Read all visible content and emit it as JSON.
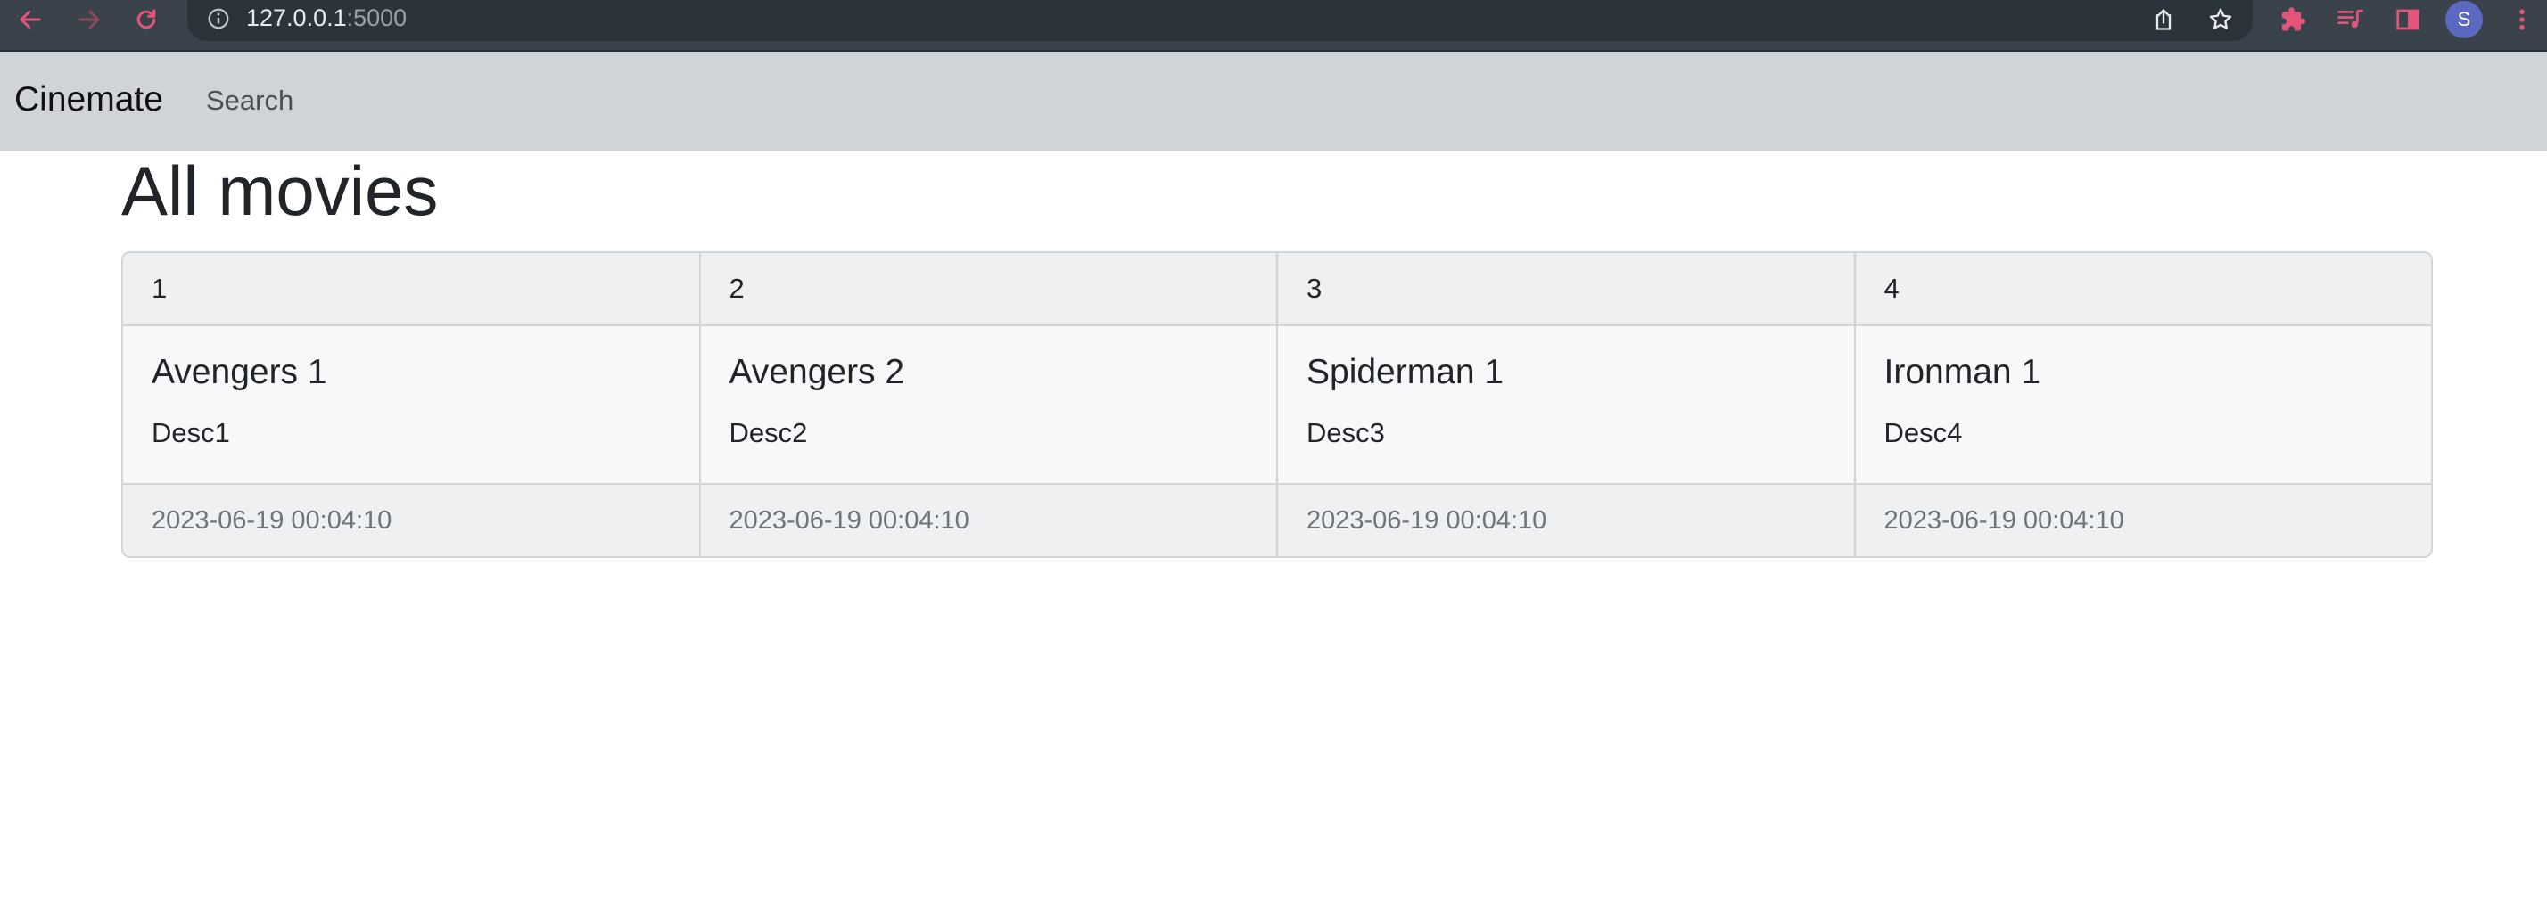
{
  "browser": {
    "url_host": "127.0.0.1",
    "url_port": ":5000",
    "profile_initial": "S",
    "colors": {
      "chrome_bg": "#3a434c",
      "accent_icon": "#e2557a"
    },
    "icons": {
      "back": "back-arrow-icon",
      "forward": "forward-arrow-icon",
      "reload": "reload-icon",
      "info": "info-icon",
      "share": "share-icon",
      "bookmark": "star-icon",
      "extensions": "puzzle-icon",
      "media": "media-queue-icon",
      "side_panel": "side-panel-icon",
      "menu": "kebab-menu-icon"
    }
  },
  "navbar": {
    "brand": "Cinemate",
    "links": [
      {
        "label": "Search"
      }
    ]
  },
  "main": {
    "title": "All movies",
    "cards": [
      {
        "header": "1",
        "title": "Avengers 1",
        "text": "Desc1",
        "footer": "2023-06-19 00:04:10"
      },
      {
        "header": "2",
        "title": "Avengers 2",
        "text": "Desc2",
        "footer": "2023-06-19 00:04:10"
      },
      {
        "header": "3",
        "title": "Spiderman 1",
        "text": "Desc3",
        "footer": "2023-06-19 00:04:10"
      },
      {
        "header": "4",
        "title": "Ironman 1",
        "text": "Desc4",
        "footer": "2023-06-19 00:04:10"
      }
    ]
  }
}
